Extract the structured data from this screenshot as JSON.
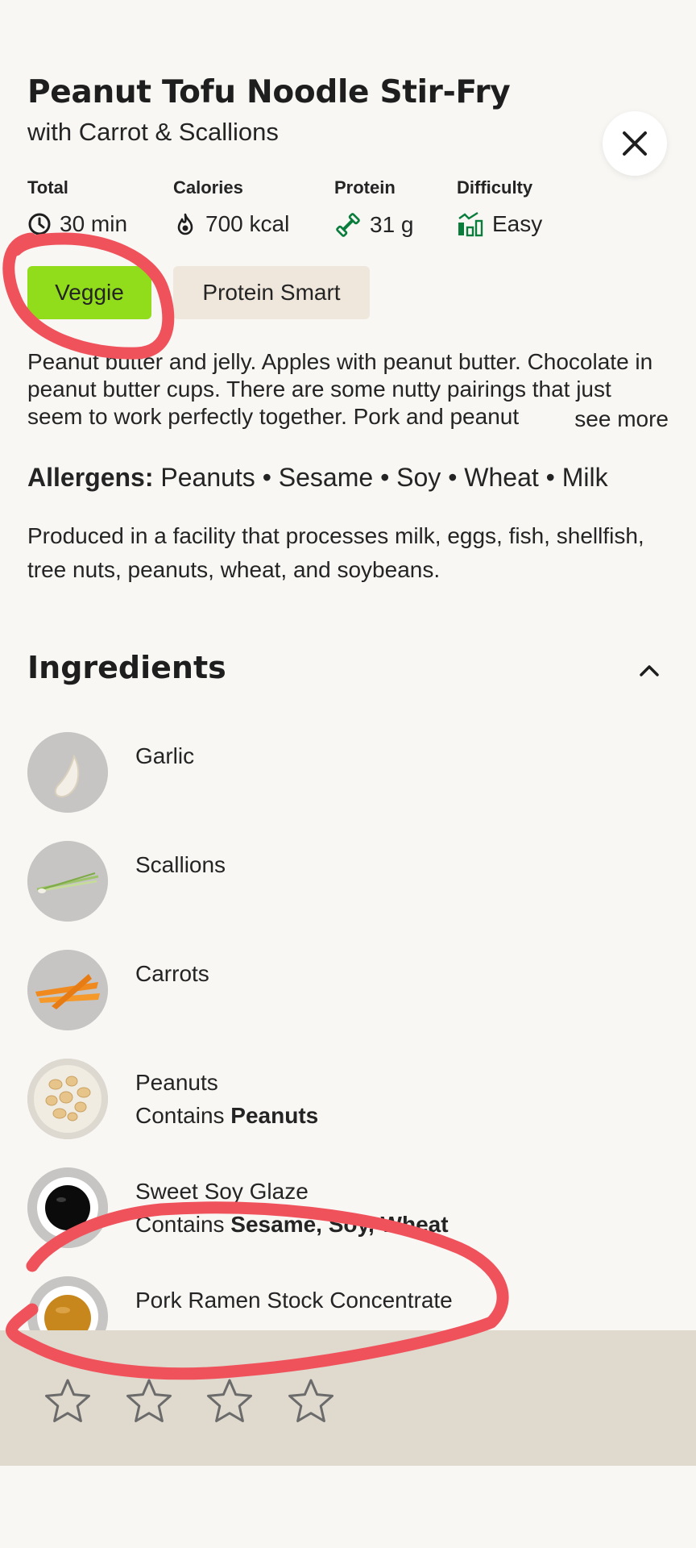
{
  "recipe": {
    "title": "Peanut Tofu Noodle Stir-Fry",
    "subtitle": "with Carrot & Scallions"
  },
  "close": {
    "icon": "close-icon"
  },
  "stats": [
    {
      "label": "Total",
      "value": "30 min",
      "icon": "clock-icon"
    },
    {
      "label": "Calories",
      "value": "700 kcal",
      "icon": "flame-icon"
    },
    {
      "label": "Protein",
      "value": "31 g",
      "icon": "dumbbell-icon"
    },
    {
      "label": "Difficulty",
      "value": "Easy",
      "icon": "bar-chart-icon"
    }
  ],
  "tags": [
    {
      "label": "Veggie",
      "color": "#91dd1b"
    },
    {
      "label": "Protein Smart",
      "color": "#efe7dc"
    }
  ],
  "description": "Peanut butter and jelly. Apples with peanut butter. Chocolate in peanut butter cups. There are some nutty pairings that just seem to work perfectly together. Pork and peanut",
  "see_more_label": "see more",
  "allergens": {
    "label": "Allergens:",
    "list": "Peanuts • Sesame • Soy • Wheat • Milk"
  },
  "facility_note": "Produced in a facility that processes milk, eggs, fish, shellfish, tree nuts, peanuts, wheat, and soybeans.",
  "ingredients_section": {
    "heading": "Ingredients",
    "items": [
      {
        "name": "Garlic",
        "contains_prefix": "",
        "contains": "",
        "icon": "garlic-image"
      },
      {
        "name": "Scallions",
        "contains_prefix": "",
        "contains": "",
        "icon": "scallions-image"
      },
      {
        "name": "Carrots",
        "contains_prefix": "",
        "contains": "",
        "icon": "carrots-image"
      },
      {
        "name": "Peanuts",
        "contains_prefix": "Contains ",
        "contains": "Peanuts",
        "icon": "peanuts-image"
      },
      {
        "name": "Sweet Soy Glaze",
        "contains_prefix": "Contains ",
        "contains": "Sesame, Soy, Wheat",
        "icon": "soy-glaze-image"
      },
      {
        "name": "Pork Ramen Stock Concentrate",
        "contains_prefix": "",
        "contains": "",
        "icon": "stock-concentrate-image"
      }
    ]
  },
  "rating": {
    "stars": 4,
    "filled": 0
  },
  "colors": {
    "background": "#f8f7f4",
    "veggie_tag": "#91dd1b",
    "protein_tag": "#efe7dc",
    "rating_bar": "#e0d9ce",
    "stat_icon_green": "#0a7d3c",
    "annotation_red": "#f0525c"
  }
}
